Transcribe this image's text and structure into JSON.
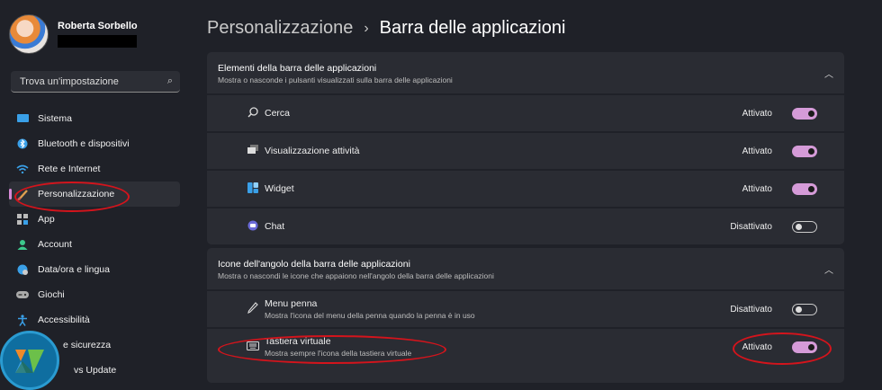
{
  "user": {
    "name": "Roberta Sorbello"
  },
  "search": {
    "placeholder": "Trova un'impostazione"
  },
  "sidebar": {
    "items": [
      {
        "label": "Sistema",
        "icon": "monitor-icon"
      },
      {
        "label": "Bluetooth e dispositivi",
        "icon": "bluetooth-icon"
      },
      {
        "label": "Rete e Internet",
        "icon": "wifi-icon"
      },
      {
        "label": "Personalizzazione",
        "icon": "brush-icon",
        "active": true
      },
      {
        "label": "App",
        "icon": "apps-icon"
      },
      {
        "label": "Account",
        "icon": "account-icon"
      },
      {
        "label": "Data/ora e lingua",
        "icon": "globe-icon"
      },
      {
        "label": "Giochi",
        "icon": "gamepad-icon"
      },
      {
        "label": "Accessibilità",
        "icon": "accessibility-icon"
      },
      {
        "label": "e sicurezza",
        "icon": "shield-icon"
      },
      {
        "label": "vs Update",
        "icon": "update-icon"
      }
    ]
  },
  "breadcrumb": {
    "parent": "Personalizzazione",
    "separator": "›",
    "current": "Barra delle applicazioni"
  },
  "section1": {
    "title": "Elementi della barra delle applicazioni",
    "subtitle": "Mostra o nasconde i pulsanti visualizzati sulla barra delle applicazioni",
    "rows": [
      {
        "label": "Cerca",
        "state": "Attivato",
        "on": true,
        "icon": "search-icon"
      },
      {
        "label": "Visualizzazione attività",
        "state": "Attivato",
        "on": true,
        "icon": "task-view-icon"
      },
      {
        "label": "Widget",
        "state": "Attivato",
        "on": true,
        "icon": "widget-icon"
      },
      {
        "label": "Chat",
        "state": "Disattivato",
        "on": false,
        "icon": "chat-icon"
      }
    ]
  },
  "section2": {
    "title": "Icone dell'angolo della barra delle applicazioni",
    "subtitle": "Mostra o nascondi le icone che appaiono nell'angolo della barra delle applicazioni",
    "rows": [
      {
        "label": "Menu penna",
        "sub": "Mostra l'icona del menu della penna quando la penna è in uso",
        "state": "Disattivato",
        "on": false,
        "icon": "pen-icon"
      },
      {
        "label": "Tastiera virtuale",
        "sub": "Mostra sempre l'icona della tastiera virtuale",
        "state": "Attivato",
        "on": true,
        "icon": "keyboard-icon"
      }
    ]
  },
  "colors": {
    "accent": "#d59bd8",
    "annotation": "#d4141c",
    "background": "#1f2128",
    "card": "#2a2c33"
  }
}
